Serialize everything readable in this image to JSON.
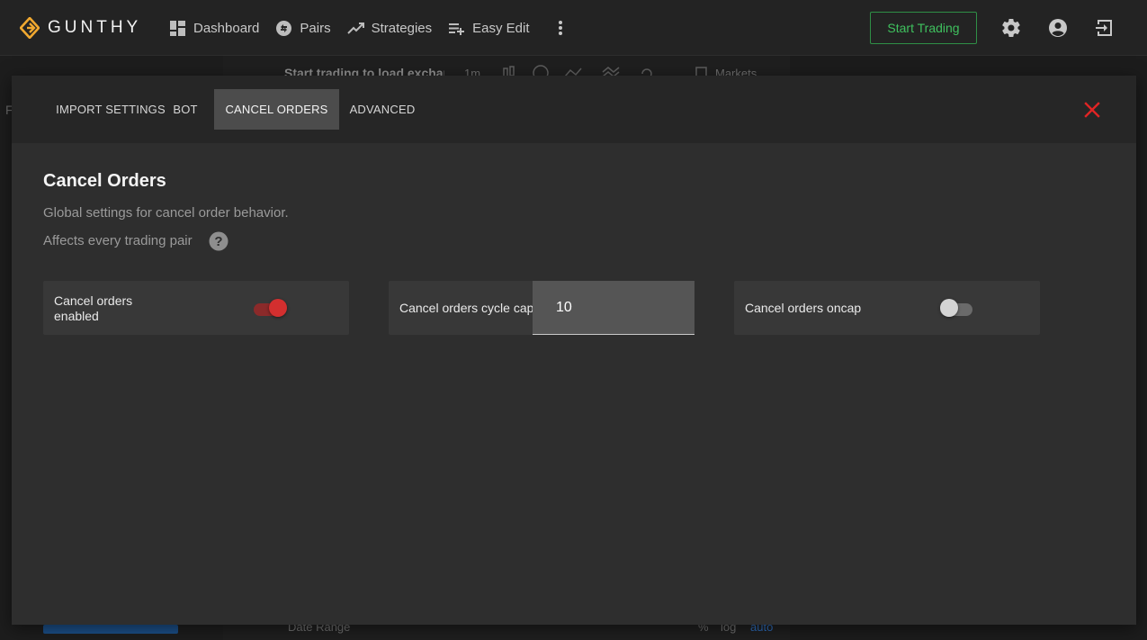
{
  "app": {
    "logo_text": "GUNTHY"
  },
  "nav": {
    "items": [
      {
        "label": "Dashboard",
        "icon": "dashboard-icon"
      },
      {
        "label": "Pairs",
        "icon": "pairs-icon"
      },
      {
        "label": "Strategies",
        "icon": "strategies-icon"
      },
      {
        "label": "Easy Edit",
        "icon": "easy-edit-icon"
      }
    ],
    "more_icon": "more-vertical-icon",
    "start_trading_label": "Start Trading",
    "right_icons": [
      "gear-icon",
      "account-icon",
      "logout-icon"
    ]
  },
  "background": {
    "toolbar_text": "Start trading to load exchange",
    "interval": "1m",
    "markets_label": "Markets",
    "date_range_label": "Date Range",
    "percent_label": "%",
    "log_label": "log",
    "auto_label": "auto",
    "edge_letter": "F"
  },
  "modal": {
    "tabs": [
      {
        "label": "IMPORT SETTINGS",
        "active": false
      },
      {
        "label": "BOT",
        "active": false
      },
      {
        "label": "CANCEL ORDERS",
        "active": true
      },
      {
        "label": "ADVANCED",
        "active": false
      }
    ],
    "close_icon": "close-icon",
    "section": {
      "title": "Cancel Orders",
      "description": "Global settings for cancel order behavior.",
      "note": "Affects every trading pair"
    },
    "settings": {
      "cancel_orders_enabled": {
        "label": "Cancel orders enabled",
        "value": true
      },
      "cancel_orders_cycle_cap": {
        "label": "Cancel orders cycle cap",
        "value": "10"
      },
      "cancel_orders_oncap": {
        "label": "Cancel orders oncap",
        "value": false
      }
    }
  },
  "colors": {
    "accent_red": "#d32f2f",
    "accent_green": "#3fc15e",
    "logo_gold": "#f0a830"
  }
}
